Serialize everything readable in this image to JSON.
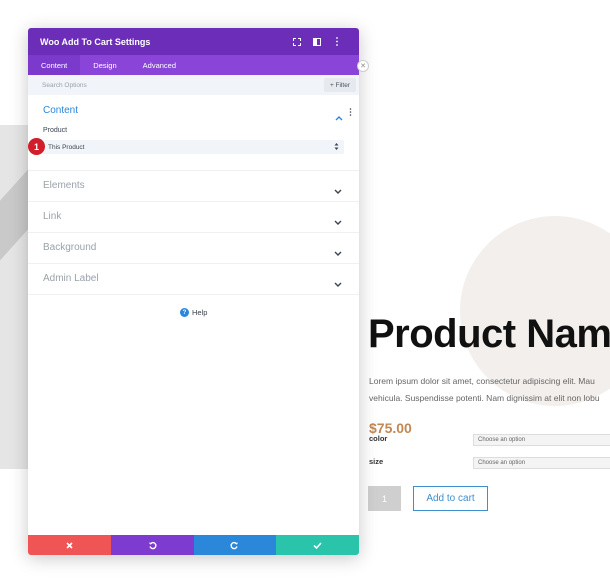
{
  "modal": {
    "title": "Woo Add To Cart Settings",
    "tabs": [
      {
        "label": "Content",
        "active": true
      },
      {
        "label": "Design",
        "active": false
      },
      {
        "label": "Advanced",
        "active": false
      }
    ],
    "search_placeholder": "Search Options",
    "filter_label": "+ Filter",
    "content_section": {
      "title": "Content",
      "field_label": "Product",
      "field_value": "This Product"
    },
    "badge": "1",
    "collapsed_sections": [
      "Elements",
      "Link",
      "Background",
      "Admin Label"
    ],
    "help_label": "Help",
    "colors": {
      "header": "#6c2eb9",
      "tabs": "#8a45d8",
      "accent": "#2b87da",
      "cancel": "#ef5555",
      "undo": "#7e3bd0",
      "redo": "#2b87da",
      "save": "#29c4a9",
      "badge": "#d21d2b"
    },
    "icons": {
      "expand": "fullscreen-icon",
      "layout": "split-view-icon",
      "more": "kebab-icon"
    }
  },
  "page": {
    "product_name": "Product Name",
    "description_line1": "Lorem ipsum dolor sit amet, consectetur adipiscing elit. Mau",
    "description_line2": "vehicula. Suspendisse potenti. Nam dignissim at elit non lobu",
    "price": "$75.00",
    "price_color": "#c28753",
    "variations": [
      {
        "label": "color",
        "placeholder": "Choose an option"
      },
      {
        "label": "size",
        "placeholder": "Choose an option"
      }
    ],
    "quantity": "1",
    "add_to_cart": "Add to cart"
  }
}
